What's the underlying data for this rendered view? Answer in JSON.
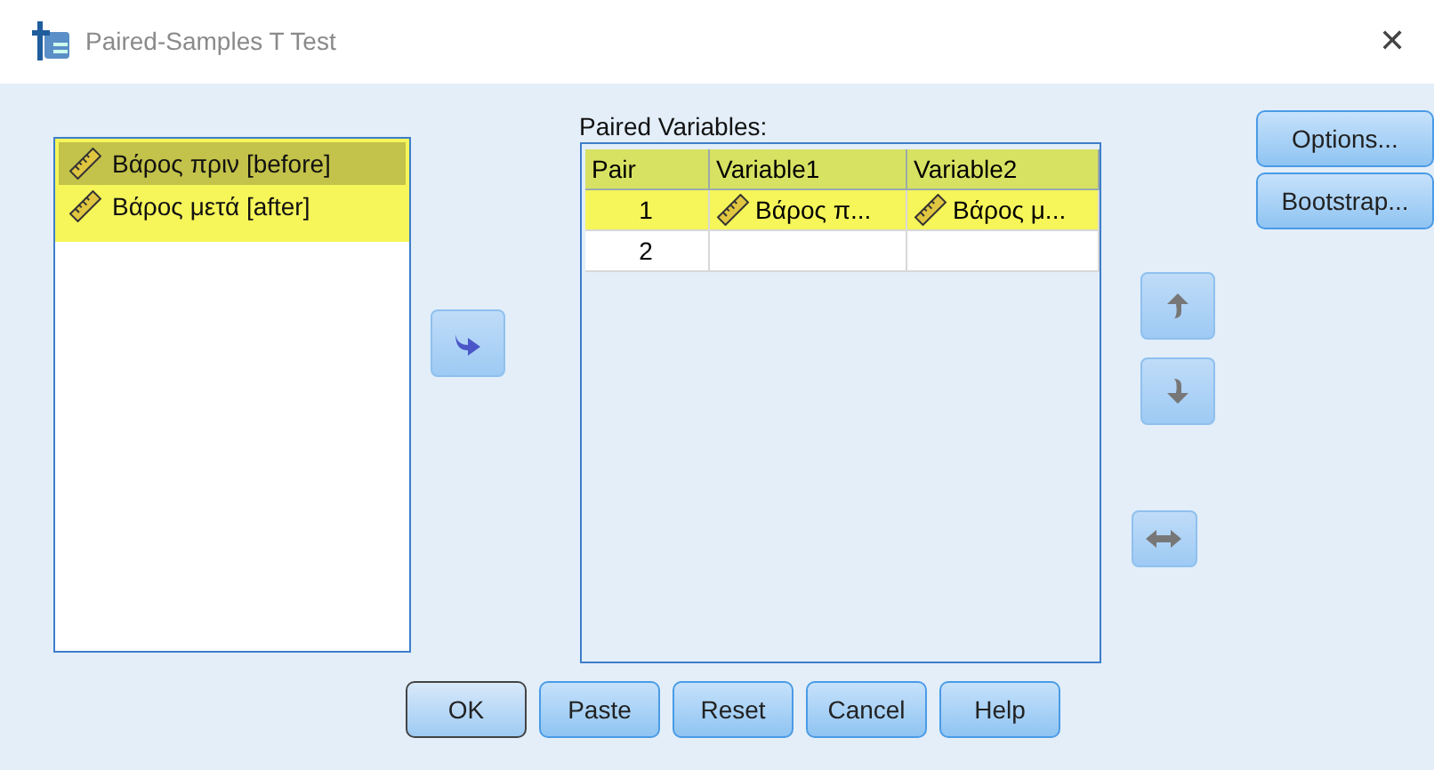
{
  "window": {
    "title": "Paired-Samples T Test",
    "close": "✕"
  },
  "source_list": {
    "items": [
      {
        "label": "Βάρος πριν [before]",
        "selected": true,
        "highlighted": true
      },
      {
        "label": "Βάρος μετά [after]",
        "selected": false,
        "highlighted": true
      }
    ]
  },
  "paired": {
    "label": "Paired Variables:",
    "columns": [
      "Pair",
      "Variable1",
      "Variable2"
    ],
    "rows": [
      {
        "pair": "1",
        "variable1": "Βάρος π...",
        "variable2": "Βάρος μ...",
        "highlighted": true
      },
      {
        "pair": "2",
        "highlighted": false
      }
    ]
  },
  "side_buttons": [
    {
      "label": "Options..."
    },
    {
      "label": "Bootstrap..."
    }
  ],
  "bottom_buttons": [
    {
      "label": "OK",
      "default": true
    },
    {
      "label": "Paste",
      "default": false
    },
    {
      "label": "Reset",
      "default": false
    },
    {
      "label": "Cancel",
      "default": false
    },
    {
      "label": "Help",
      "default": false
    }
  ]
}
